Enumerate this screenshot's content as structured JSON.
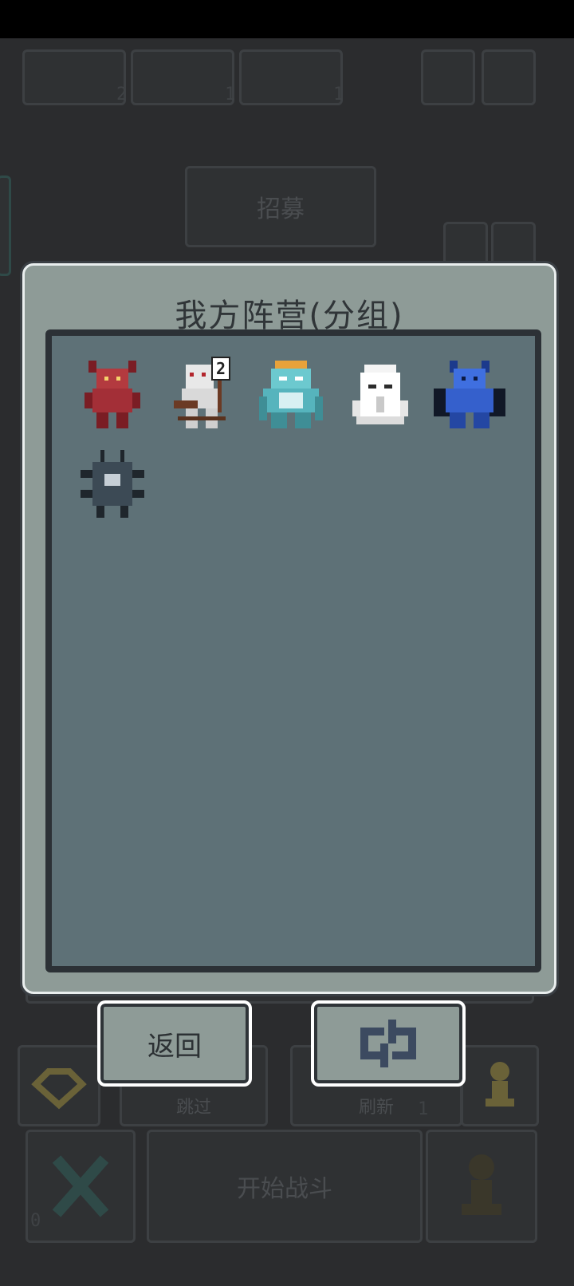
{
  "background": {
    "recruit_label": "招募",
    "skip_label": "跳过",
    "refresh_label": "刷新",
    "start_label": "开始战斗",
    "counts": [
      "2",
      "1",
      "1"
    ],
    "refresh_count": "1",
    "bottom_count": "0"
  },
  "modal": {
    "title": "我方阵营(分组)",
    "units": [
      {
        "name": "red-demon",
        "badge": ""
      },
      {
        "name": "skeleton-warrior",
        "badge": "2"
      },
      {
        "name": "cyan-golem",
        "badge": ""
      },
      {
        "name": "white-ghost",
        "badge": ""
      },
      {
        "name": "blue-gargoyle",
        "badge": ""
      },
      {
        "name": "dark-spider-beast",
        "badge": ""
      }
    ]
  },
  "buttons": {
    "back_label": "返回",
    "swap_icon": "cycle-arrows-icon"
  },
  "colors": {
    "panel": "#8e9b97",
    "roster_bg": "#5e7177",
    "frame": "#2c3136"
  }
}
